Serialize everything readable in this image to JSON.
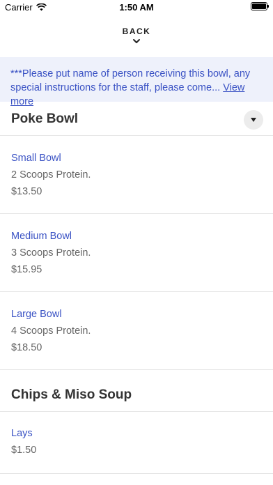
{
  "status_bar": {
    "carrier": "Carrier",
    "time": "1:50 AM"
  },
  "nav": {
    "back_label": "BACK"
  },
  "notice": {
    "text": "***Please put name of person receiving this bowl, any special instructions for the staff, please come... ",
    "view_more": "View more"
  },
  "sections": [
    {
      "title": "Poke Bowl",
      "items": [
        {
          "name": "Small Bowl",
          "description": "2 Scoops Protein.",
          "price": "$13.50"
        },
        {
          "name": "Medium Bowl",
          "description": "3 Scoops Protein.",
          "price": "$15.95"
        },
        {
          "name": "Large Bowl",
          "description": "4 Scoops Protein.",
          "price": "$18.50"
        }
      ]
    },
    {
      "title": "Chips & Miso Soup",
      "items": [
        {
          "name": "Lays",
          "price": "$1.50"
        }
      ]
    }
  ],
  "colors": {
    "accent": "#3a52c4",
    "notice_bg": "#eef1fb"
  },
  "icons": [
    "wifi-icon",
    "battery-icon",
    "chevron-down-icon",
    "caret-down-icon"
  ]
}
